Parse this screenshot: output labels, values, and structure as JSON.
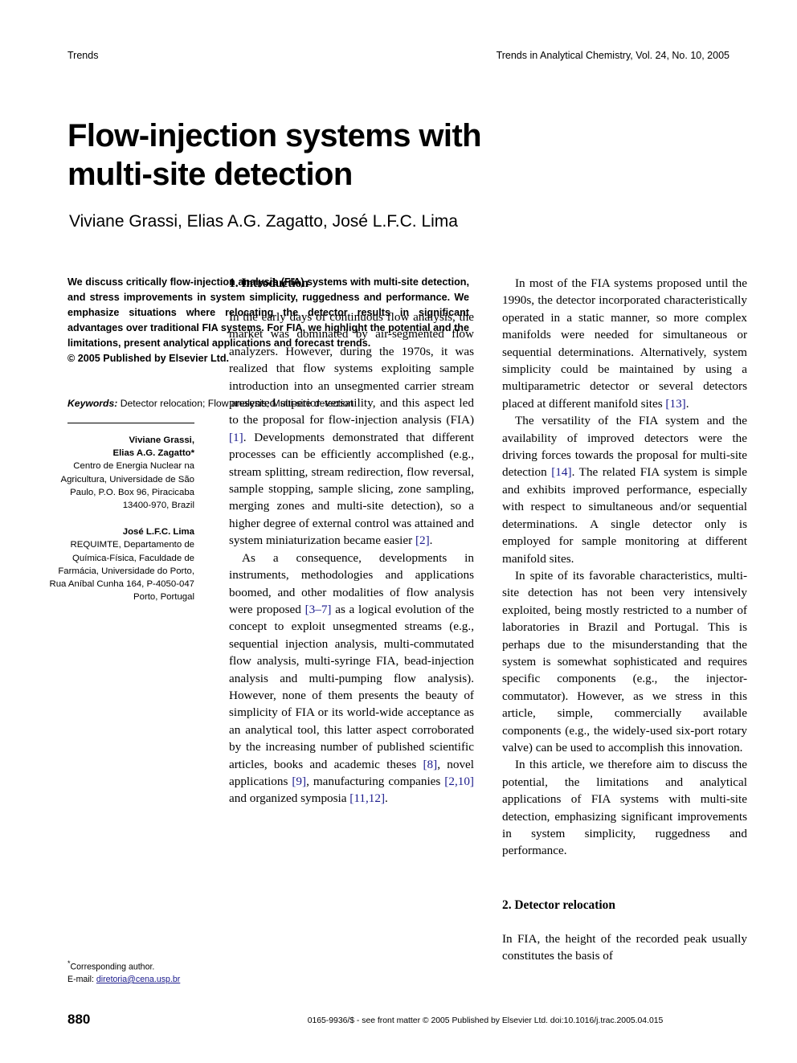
{
  "running_head": {
    "left": "Trends",
    "right": "Trends in Analytical Chemistry, Vol. 24, No. 10, 2005"
  },
  "title": {
    "line1": "Flow-injection systems with",
    "line2": "multi-site detection"
  },
  "authors": "Viviane Grassi, Elias A.G. Zagatto, José L.F.C. Lima",
  "abstract": {
    "text": "We discuss critically flow-injection analysis (FIA) systems with multi-site detection, and stress improvements in system simplicity, ruggedness and performance. We emphasize situations where relocating the detector results in significant advantages over traditional FIA systems. For FIA, we highlight the potential and the limitations, present analytical applications and forecast trends.",
    "copyright": "© 2005 Published by Elsevier Ltd."
  },
  "keywords": {
    "label": "Keywords:",
    "value": " Detector relocation; Flow analysis; Multi-site detection"
  },
  "affiliations": {
    "group1": {
      "names": "Viviane Grassi,\nElias A.G. Zagatto*",
      "address": "Centro de Energia Nuclear na Agricultura, Universidade de São Paulo, P.O. Box 96, Piracicaba 13400-970, Brazil"
    },
    "group2": {
      "names": "José L.F.C. Lima",
      "address": "REQUIMTE, Departamento de Química-Física, Faculdade de Farmácia, Universidade do Porto, Rua Aníbal Cunha 164, P-4050-047 Porto, Portugal"
    }
  },
  "footnote": {
    "corresponding": "Corresponding author.",
    "email_label": "E-mail: ",
    "email": "diretoria@cena.usp.br"
  },
  "sections": {
    "intro_heading": "1. Introduction",
    "detector_heading": "2. Detector relocation"
  },
  "body": {
    "p1_a": "In the early days of continuous flow analysis, the market was dominated by air-segmented flow analyzers. However, during the 1970s, it was realized that flow systems exploiting sample introduction into an unsegmented carrier stream presented superior versatility, and this aspect led to the proposal for flow-injection analysis (FIA) ",
    "p1_ref1": "[1]",
    "p1_b": ". Developments demonstrated that different processes can be efficiently accomplished (e.g., stream splitting, stream redirection, flow reversal, sample stopping, sample slicing, zone sampling, merging zones and multi-site detection), so a higher degree of external control was attained and system miniaturization became easier ",
    "p1_ref2": "[2]",
    "p1_c": ".",
    "p2_a": "As a consequence, developments in instruments, methodologies and applications boomed, and other modalities of flow analysis were proposed ",
    "p2_ref1": "[3–7]",
    "p2_b": " as a logical evolution of the concept to exploit unsegmented streams (e.g., sequential injection analysis, multi-commutated flow analysis, multi-syringe FIA, bead-injection analysis and multi-pumping flow analysis). However, none of them presents the beauty of simplicity of FIA or its world-wide acceptance as an analytical tool, this latter aspect corroborated by the increasing number of published scientific articles, books and academic theses ",
    "p2_ref2": "[8]",
    "p2_c": ", novel applications ",
    "p2_ref3": "[9]",
    "p2_d": ", manufacturing companies ",
    "p2_ref4": "[2,10]",
    "p2_e": " and organized symposia ",
    "p2_ref5": "[11,12]",
    "p2_f": ".",
    "p3_a": "In most of the FIA systems proposed until the 1990s, the detector incorporated characteristically operated in a static manner, so more complex manifolds were needed for simultaneous or sequential determinations. Alternatively, system simplicity could be maintained by using a multiparametric detector or several detectors placed at different manifold sites ",
    "p3_ref1": "[13]",
    "p3_b": ".",
    "p4_a": "The versatility of the FIA system and the availability of improved detectors were the driving forces towards the proposal for multi-site detection ",
    "p4_ref1": "[14]",
    "p4_b": ". The related FIA system is simple and exhibits improved performance, especially with respect to simultaneous and/or sequential determinations. A single detector only is employed for sample monitoring at different manifold sites.",
    "p5": "In spite of its favorable characteristics, multi-site detection has not been very intensively exploited, being mostly restricted to a number of laboratories in Brazil and Portugal. This is perhaps due to the misunderstanding that the system is somewhat sophisticated and requires specific components (e.g., the injector-commutator). However, as we stress in this article, simple, commercially available components (e.g., the widely-used six-port rotary valve) can be used to accomplish this innovation.",
    "p6": "In this article, we therefore aim to discuss the potential, the limitations and analytical applications of FIA systems with multi-site detection, emphasizing significant improvements in system simplicity, ruggedness and performance.",
    "p7": "In FIA, the height of the recorded peak usually constitutes the basis of"
  },
  "footer": {
    "page_number": "880",
    "imprint": "0165-9936/$ - see front matter © 2005 Published by Elsevier Ltd.   doi:10.1016/j.trac.2005.04.015"
  },
  "colors": {
    "reference_link": "#1a1a8c",
    "text": "#000000",
    "background": "#ffffff"
  }
}
